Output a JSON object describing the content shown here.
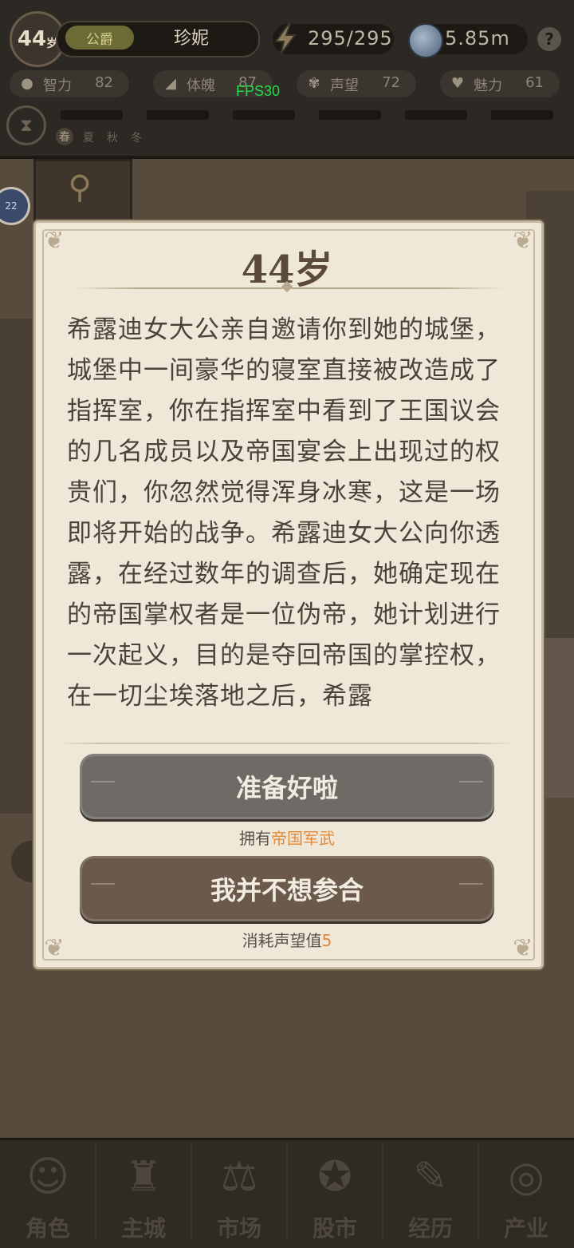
{
  "header": {
    "age": "44",
    "age_unit": "岁",
    "title_badge": "公爵",
    "player_name": "珍妮",
    "energy": "295/295",
    "money": "5.85m",
    "help_icon": "question-icon"
  },
  "stats": [
    {
      "label": "智力",
      "value": "82",
      "icon": "brain-icon"
    },
    {
      "label": "体魄",
      "value": "87",
      "icon": "muscle-icon"
    },
    {
      "label": "声望",
      "value": "72",
      "icon": "laurel-icon"
    },
    {
      "label": "魅力",
      "value": "61",
      "icon": "heartbeat-icon"
    }
  ],
  "fps": "FPS30",
  "seasons": [
    "春",
    "夏",
    "秋",
    "冬"
  ],
  "map_badge": "22",
  "dialog": {
    "title": "44岁",
    "story": "希露迪女大公亲自邀请你到她的城堡，城堡中一间豪华的寝室直接被改造成了指挥室，你在指挥室中看到了王国议会的几名成员以及帝国宴会上出现过的权贵们，你忽然觉得浑身冰寒，这是一场即将开始的战争。希露迪女大公向你透露，在经过数年的调查后，她确定现在的帝国掌权者是一位伪帝，她计划进行一次起义，目的是夺回帝国的掌控权，在一切尘埃落地之后，希露",
    "choice1_label": "准备好啦",
    "choice1_note_prefix": "拥有",
    "choice1_note_highlight": "帝国军武",
    "choice2_label": "我并不想参合",
    "choice2_note_prefix": "消耗声望值",
    "choice2_note_highlight": "5"
  },
  "nav": [
    {
      "label": "角色",
      "icon": "character-icon"
    },
    {
      "label": "主城",
      "icon": "castle-icon"
    },
    {
      "label": "市场",
      "icon": "scales-icon"
    },
    {
      "label": "股市",
      "icon": "stock-icon"
    },
    {
      "label": "经历",
      "icon": "scroll-icon"
    },
    {
      "label": "产业",
      "icon": "coins-icon"
    }
  ],
  "colors": {
    "highlight": "#e08a3c",
    "fps_text": "#22e04a",
    "dialog_bg": "#efe7d8"
  }
}
